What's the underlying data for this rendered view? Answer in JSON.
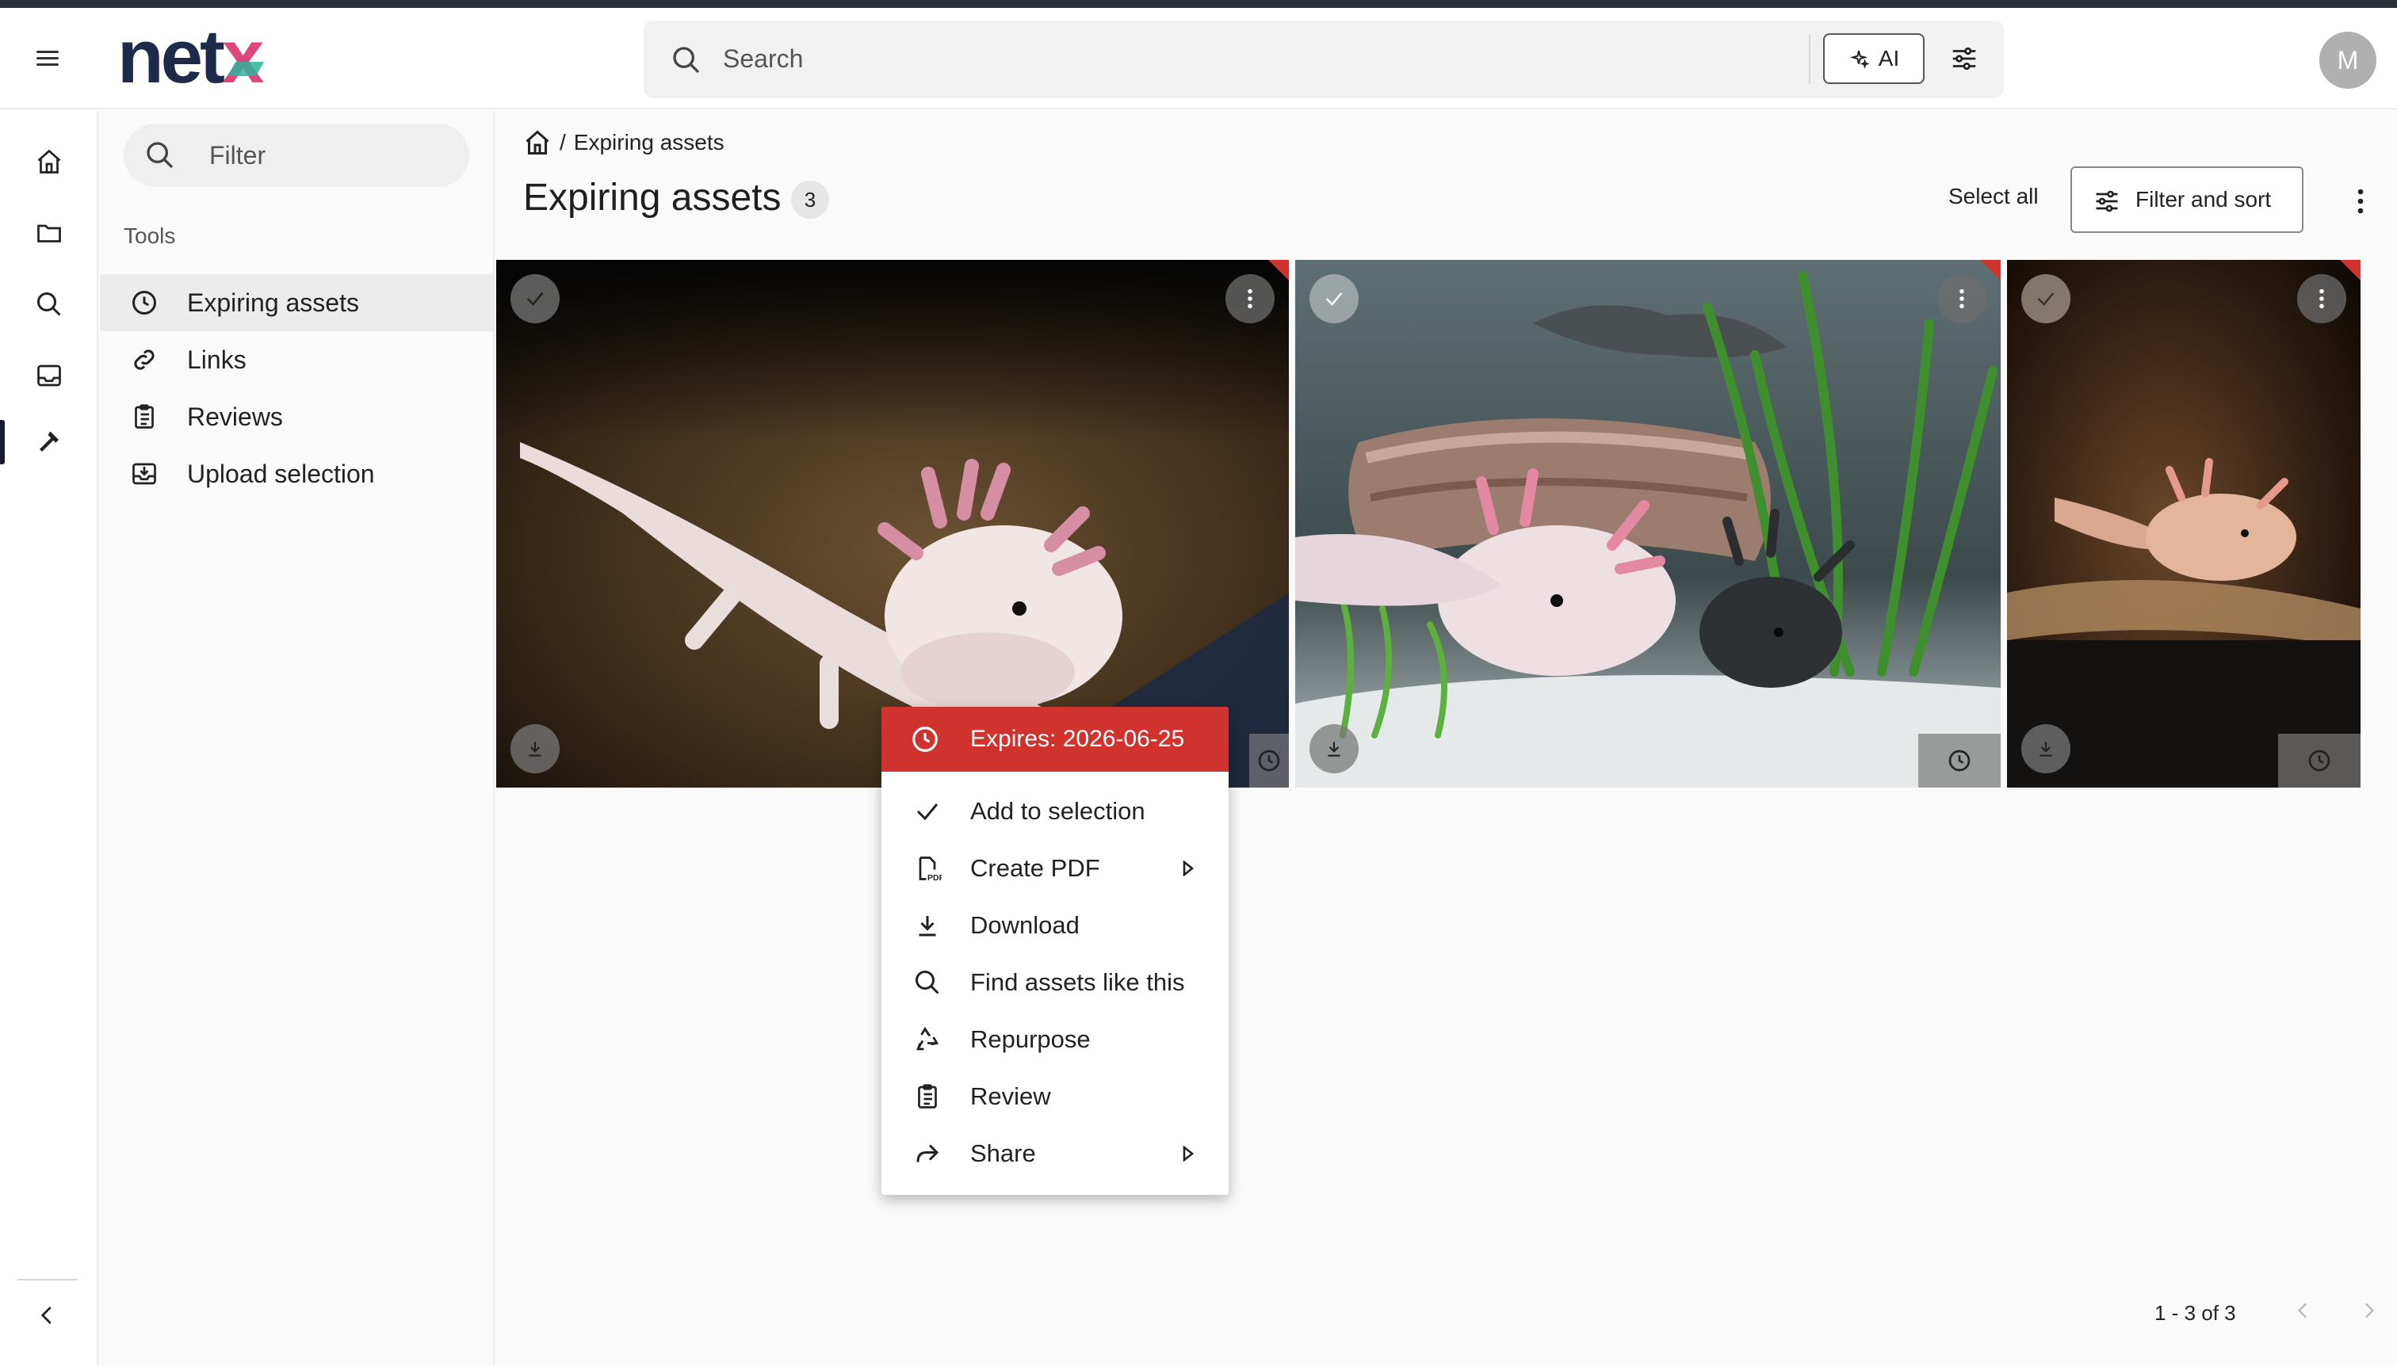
{
  "app": {
    "logo_text": "netx",
    "avatar_initial": "M"
  },
  "search": {
    "placeholder": "Search",
    "ai_label": "AI"
  },
  "sidebar": {
    "filter_placeholder": "Filter",
    "section_label": "Tools",
    "items": [
      {
        "label": "Expiring assets",
        "icon": "clock-icon",
        "active": true
      },
      {
        "label": "Links",
        "icon": "link-icon",
        "active": false
      },
      {
        "label": "Reviews",
        "icon": "clipboard-icon",
        "active": false
      },
      {
        "label": "Upload selection",
        "icon": "inbox-download-icon",
        "active": false
      }
    ]
  },
  "rail": {
    "items": [
      "home-icon",
      "folder-icon",
      "search-icon",
      "inbox-icon",
      "hammer-icon"
    ],
    "active": "hammer-icon"
  },
  "main": {
    "breadcrumb_current": "Expiring assets",
    "breadcrumb_separator": "/",
    "title": "Expiring assets",
    "count": "3",
    "select_all": "Select all",
    "filter_sort": "Filter and sort"
  },
  "context_menu": {
    "header": "Expires: 2026-06-25",
    "items": [
      {
        "label": "Add to selection",
        "icon": "check-icon",
        "submenu": false
      },
      {
        "label": "Create PDF",
        "icon": "pdf-icon",
        "submenu": true
      },
      {
        "label": "Download",
        "icon": "download-icon",
        "submenu": false
      },
      {
        "label": "Find assets like this",
        "icon": "search-icon",
        "submenu": false
      },
      {
        "label": "Repurpose",
        "icon": "recycle-icon",
        "submenu": false
      },
      {
        "label": "Review",
        "icon": "clipboard-icon",
        "submenu": false
      },
      {
        "label": "Share",
        "icon": "share-icon",
        "submenu": true
      }
    ]
  },
  "pagination": {
    "text": "1 - 3 of 3"
  },
  "colors": {
    "accent_red": "#d0322d",
    "logo_navy": "#1e2a4a",
    "logo_pink": "#e0457b",
    "logo_teal": "#2db39a"
  }
}
